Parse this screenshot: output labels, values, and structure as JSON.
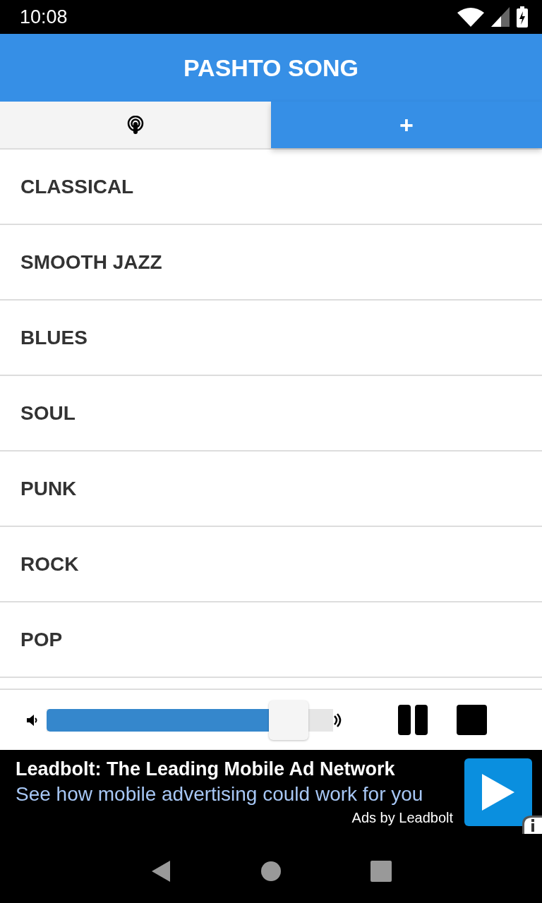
{
  "status_bar": {
    "time": "10:08"
  },
  "app_bar": {
    "title": "PASHTO SONG"
  },
  "tabs": [
    {
      "kind": "podcast",
      "selected": false
    },
    {
      "kind": "text",
      "label": "+",
      "selected": true
    }
  ],
  "categories": [
    "CLASSICAL",
    "SMOOTH JAZZ",
    "BLUES",
    "SOUL",
    "PUNK",
    "ROCK",
    "POP"
  ],
  "player": {
    "volume": {
      "level": 0.9
    },
    "playing": true
  },
  "ad": {
    "headline": "Leadbolt: The Leading Mobile Ad Network",
    "subline": "See how mobile advertising could work for you",
    "attribution": "Ads by Leadbolt"
  }
}
